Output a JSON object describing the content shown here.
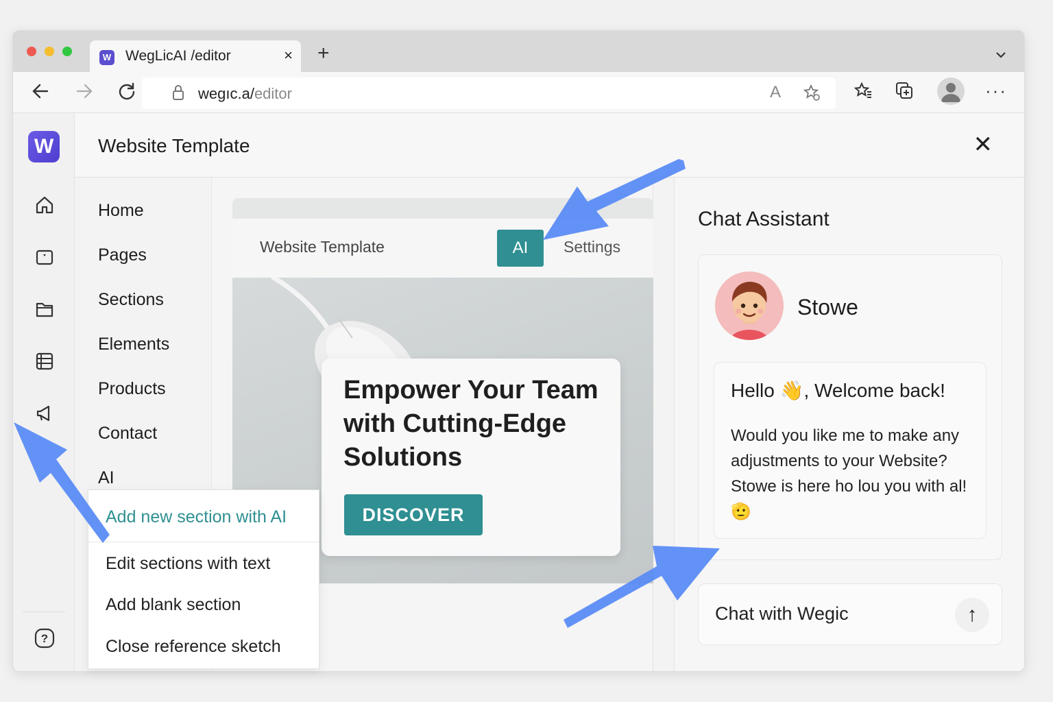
{
  "browser": {
    "tab_title": "WegLicAI /editor",
    "tab_favicon": "W",
    "tab_close": "×",
    "new_tab": "+",
    "tab_menu": "⌄",
    "url_host": "wegıc.a/",
    "url_path": "editor",
    "read_mode": "A",
    "more": "···",
    "icons": [
      "back-icon",
      "forward-icon",
      "reload-icon",
      "lock-icon",
      "favorite-add-icon",
      "favorites-icon",
      "collections-icon",
      "profile-icon",
      "more-icon"
    ]
  },
  "app": {
    "logo": "W",
    "page_title": "Website Template",
    "close": "✕",
    "rail_icons": [
      "home-icon",
      "layout-icon",
      "folder-icon",
      "list-icon",
      "megaphone-icon",
      "help-icon"
    ]
  },
  "nav": {
    "items": [
      "Home",
      "Pages",
      "Sections",
      "Elements",
      "Products",
      "Contact",
      "AI"
    ]
  },
  "preview": {
    "title": "Website Template",
    "ai_tab": "AI",
    "settings_tab": "Settings",
    "hero_title": "Empower Your Team with Cutting-Edge Solutions",
    "cta": "DISCOVER"
  },
  "dropdown": {
    "items": [
      "Add new section with AI",
      "Edit sections with text",
      "Add blank section",
      "Close reference sketch"
    ]
  },
  "chat": {
    "title": "Chat Assistant",
    "assistant_name": "Stowe",
    "greeting": "Hello 👋, Welcome back!",
    "body": "Would you like me to make any adjustments to your Website? Stowe is here ho lou you with al! 🫡",
    "input_placeholder": "Chat with Wegic",
    "send": "↑"
  },
  "colors": {
    "accent": "#2f8f92",
    "brand": "#5b4fcf",
    "arrow": "#5b8cf5"
  }
}
